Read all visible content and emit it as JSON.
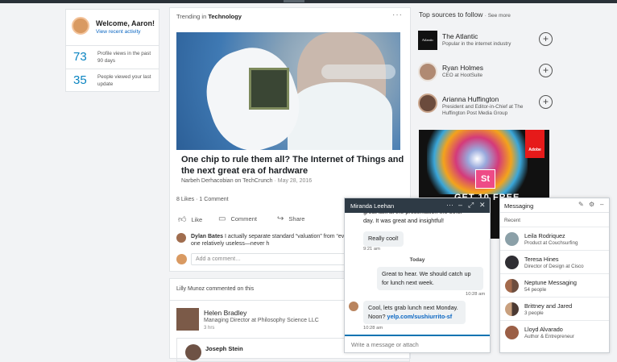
{
  "welcome": {
    "greeting": "Welcome, Aaron!",
    "link": "View recent activity",
    "stats": [
      {
        "value": "73",
        "label": "Profile views in the past 90 days"
      },
      {
        "value": "35",
        "label": "People viewed your last update"
      }
    ]
  },
  "feed": {
    "trending_prefix": "Trending in",
    "trending_topic": "Technology",
    "more": "···",
    "article_title": "One chip to rule them all? The Internet of Things and the next great era of hardware",
    "article_author": "Narbeh Derhacobian on TechCrunch",
    "article_date": "May 28, 2016",
    "likes": "8 Likes",
    "comments": "1 Comment",
    "like_label": "Like",
    "comment_label": "Comment",
    "share_label": "Share",
    "comment_author": "Dylan Bates",
    "comment_text": "I actually separate standard “valuation” from “evaluation”. Find the first one relatively useless—never h",
    "add_comment_placeholder": "Add a comment…"
  },
  "feed2": {
    "header": "Lilly Munoz commented on this",
    "name": "Helen Bradley",
    "role": "Managing Director at Philosophy Science LLC",
    "time": "3 hrs",
    "inner_name": "Joseph Stein"
  },
  "sources": {
    "title": "Top sources to follow",
    "see_more": "· See more",
    "items": [
      {
        "name": "The Atlantic",
        "desc": "Popular in the internet industry",
        "logo_text": "Atlantic"
      },
      {
        "name": "Ryan Holmes",
        "desc": "CEO at HootSuite"
      },
      {
        "name": "Arianna Huffington",
        "desc": "President and Editor-in-Chief at The Huffington Post Media Group"
      }
    ]
  },
  "ad": {
    "brand": "Adobe",
    "product": "St",
    "headline": "GET 10 FREE"
  },
  "chat": {
    "name": "Miranda Leehan",
    "msg1": "great talk at the presentation the other day. It was great and insightful!",
    "msg2": "Really cool!",
    "time2": "9:21 am",
    "day": "Today",
    "msg3": "Great to hear. We should catch up for lunch next week.",
    "time3": "10:28 am",
    "msg4": "Cool, lets grab lunch next Monday. Noon?",
    "msg4_link": "yelp.com/sushiurrito-sf",
    "time4": "10:28 am",
    "input_placeholder": "Write a message or attach"
  },
  "messaging": {
    "title": "Messaging",
    "recent": "Recent",
    "conversations": [
      {
        "name": "Leila Rodriquez",
        "desc": "Product at Couchsurfing"
      },
      {
        "name": "Teresa Hines",
        "desc": "Director of Design at Cisco"
      },
      {
        "name": "Neptune Messaging",
        "desc": "54 people"
      },
      {
        "name": "Brittney and Jared",
        "desc": "3 people"
      },
      {
        "name": "Lloyd Alvarado",
        "desc": "Author & Entrepreneur"
      }
    ]
  }
}
